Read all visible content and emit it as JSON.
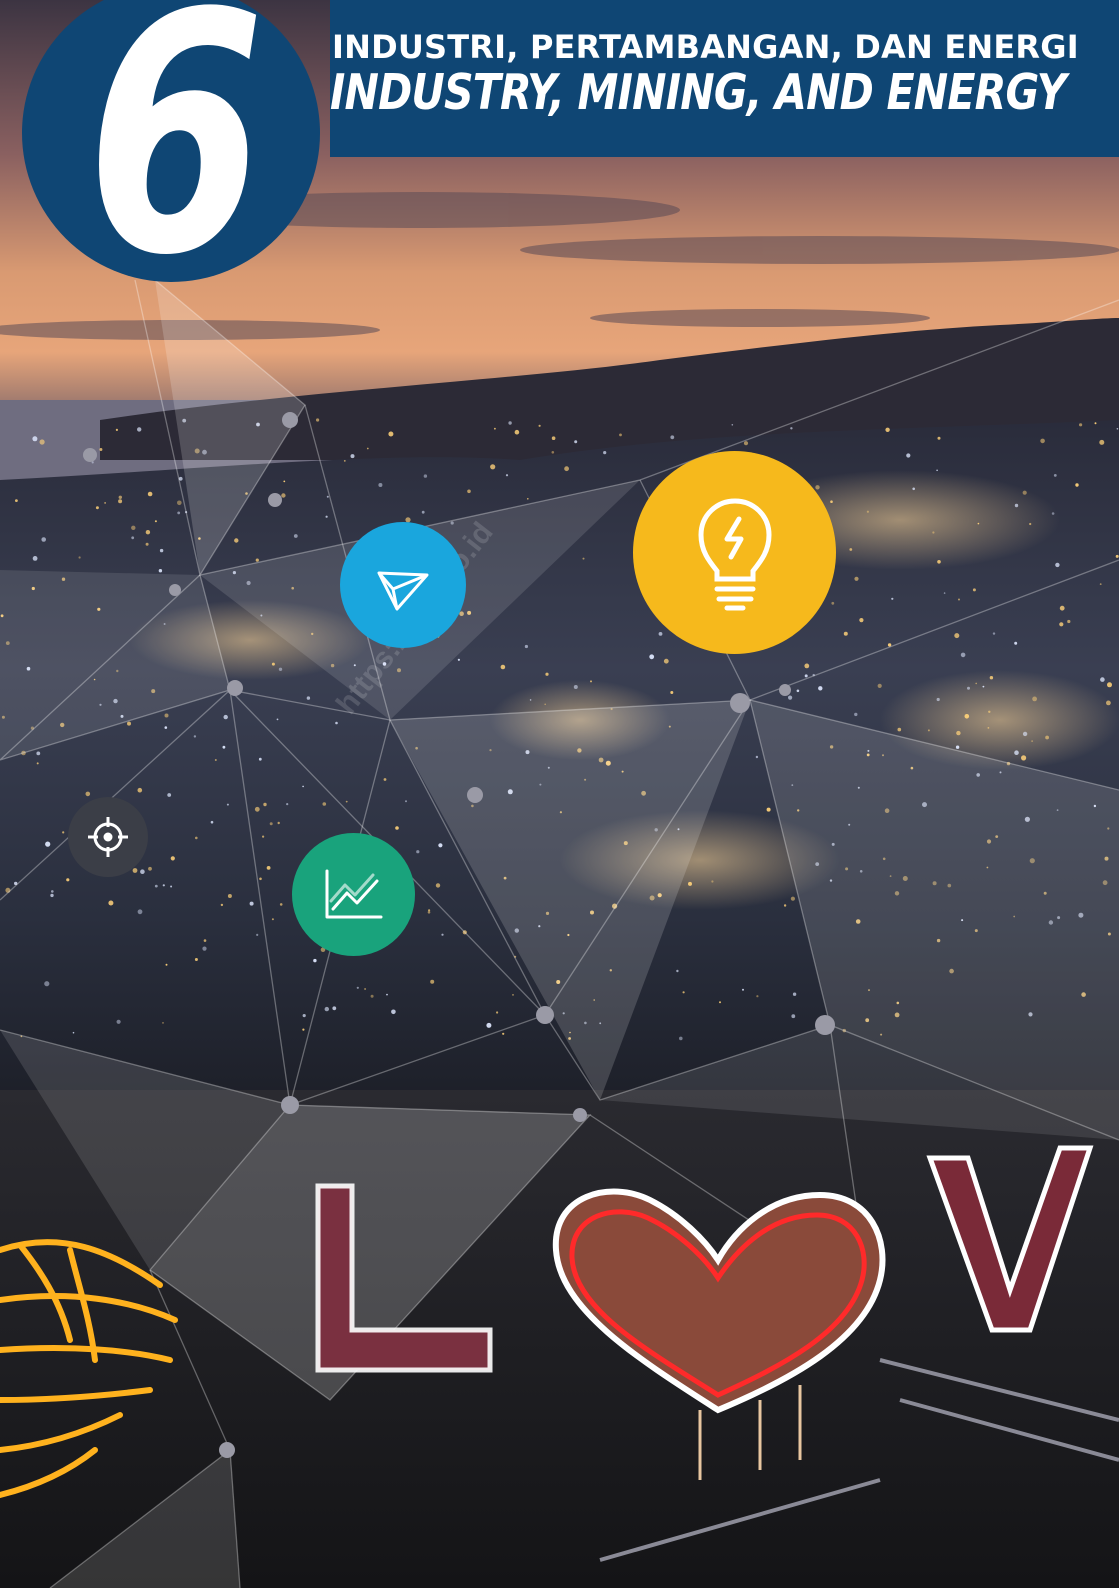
{
  "header": {
    "chapter_number": "6",
    "title_id": "INDUSTRI, PERTAMBANGAN, DAN ENERGI",
    "title_en": "INDUSTRY, MINING, AND ENERGY"
  },
  "icons": {
    "send": "paper-plane-icon",
    "bulb": "lightbulb-icon",
    "target": "crosshair-icon",
    "trend": "line-chart-icon"
  },
  "watermark": "https://bps.go.id",
  "photo": {
    "sign_letters": [
      "L",
      "V"
    ]
  },
  "colors": {
    "banner": "#0f4674",
    "send": "#1aa6dd",
    "bulb": "#f6b91c",
    "target": "#3b3e47",
    "trend": "#19a37c"
  }
}
